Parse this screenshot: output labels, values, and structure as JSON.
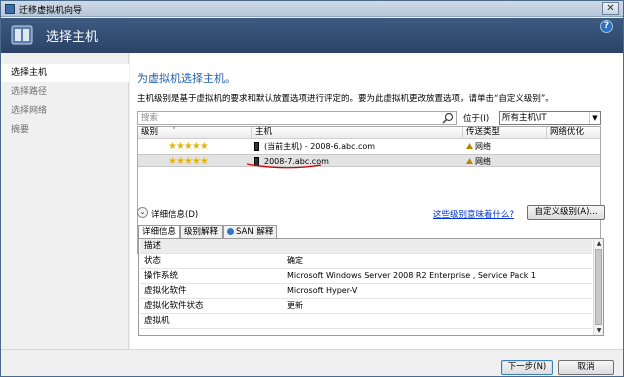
{
  "window": {
    "title": "迁移虚拟机向导"
  },
  "header": {
    "title": "选择主机"
  },
  "sidebar": {
    "items": [
      {
        "label": "选择主机",
        "active": true
      },
      {
        "label": "选择路径",
        "active": false
      },
      {
        "label": "选择网络",
        "active": false
      },
      {
        "label": "摘要",
        "active": false
      }
    ]
  },
  "main": {
    "heading": "为虚拟机选择主机。",
    "description": "主机级别是基于虚拟机的要求和默认放置选项进行评定的。要为此虚拟机更改放置选项，请单击“自定义级别”。",
    "search": {
      "placeholder": "搜索"
    },
    "location": {
      "label": "位于(I)",
      "value": "所有主机\\IT"
    },
    "columns": [
      "级别",
      "主机",
      "传送类型",
      "网络优化"
    ],
    "hosts": [
      {
        "rating": "★★★★★",
        "host": "(当前主机) - 2008-6.abc.com",
        "transfer": "网络",
        "netopt": ""
      },
      {
        "rating": "★★★★★",
        "host": "2008-7.abc.com",
        "transfer": "网络",
        "netopt": "",
        "selected": true
      }
    ],
    "details_label": "详细信息(D)",
    "rating_link": "这些级别意味着什么?",
    "custom_rating_button": "自定义级别(A)...",
    "tabs": [
      "详细信息",
      "级别解释",
      "SAN 解释"
    ],
    "details": [
      {
        "key": "描述",
        "value": "",
        "group": true
      },
      {
        "key": "状态",
        "value": "确定"
      },
      {
        "key": "操作系统",
        "value": "Microsoft Windows Server 2008 R2 Enterprise , Service Pack 1"
      },
      {
        "key": "虚拟化软件",
        "value": "Microsoft Hyper-V"
      },
      {
        "key": "虚拟化软件状态",
        "value": "更新"
      },
      {
        "key": "虚拟机",
        "value": ""
      }
    ]
  },
  "footer": {
    "next": "下一步(N)",
    "cancel": "取消"
  },
  "colors": {
    "header_bg": "#2b4266",
    "heading": "#1f5fa8",
    "link": "#0033cc",
    "star": "#e8b400",
    "annotation": "#d40000"
  }
}
